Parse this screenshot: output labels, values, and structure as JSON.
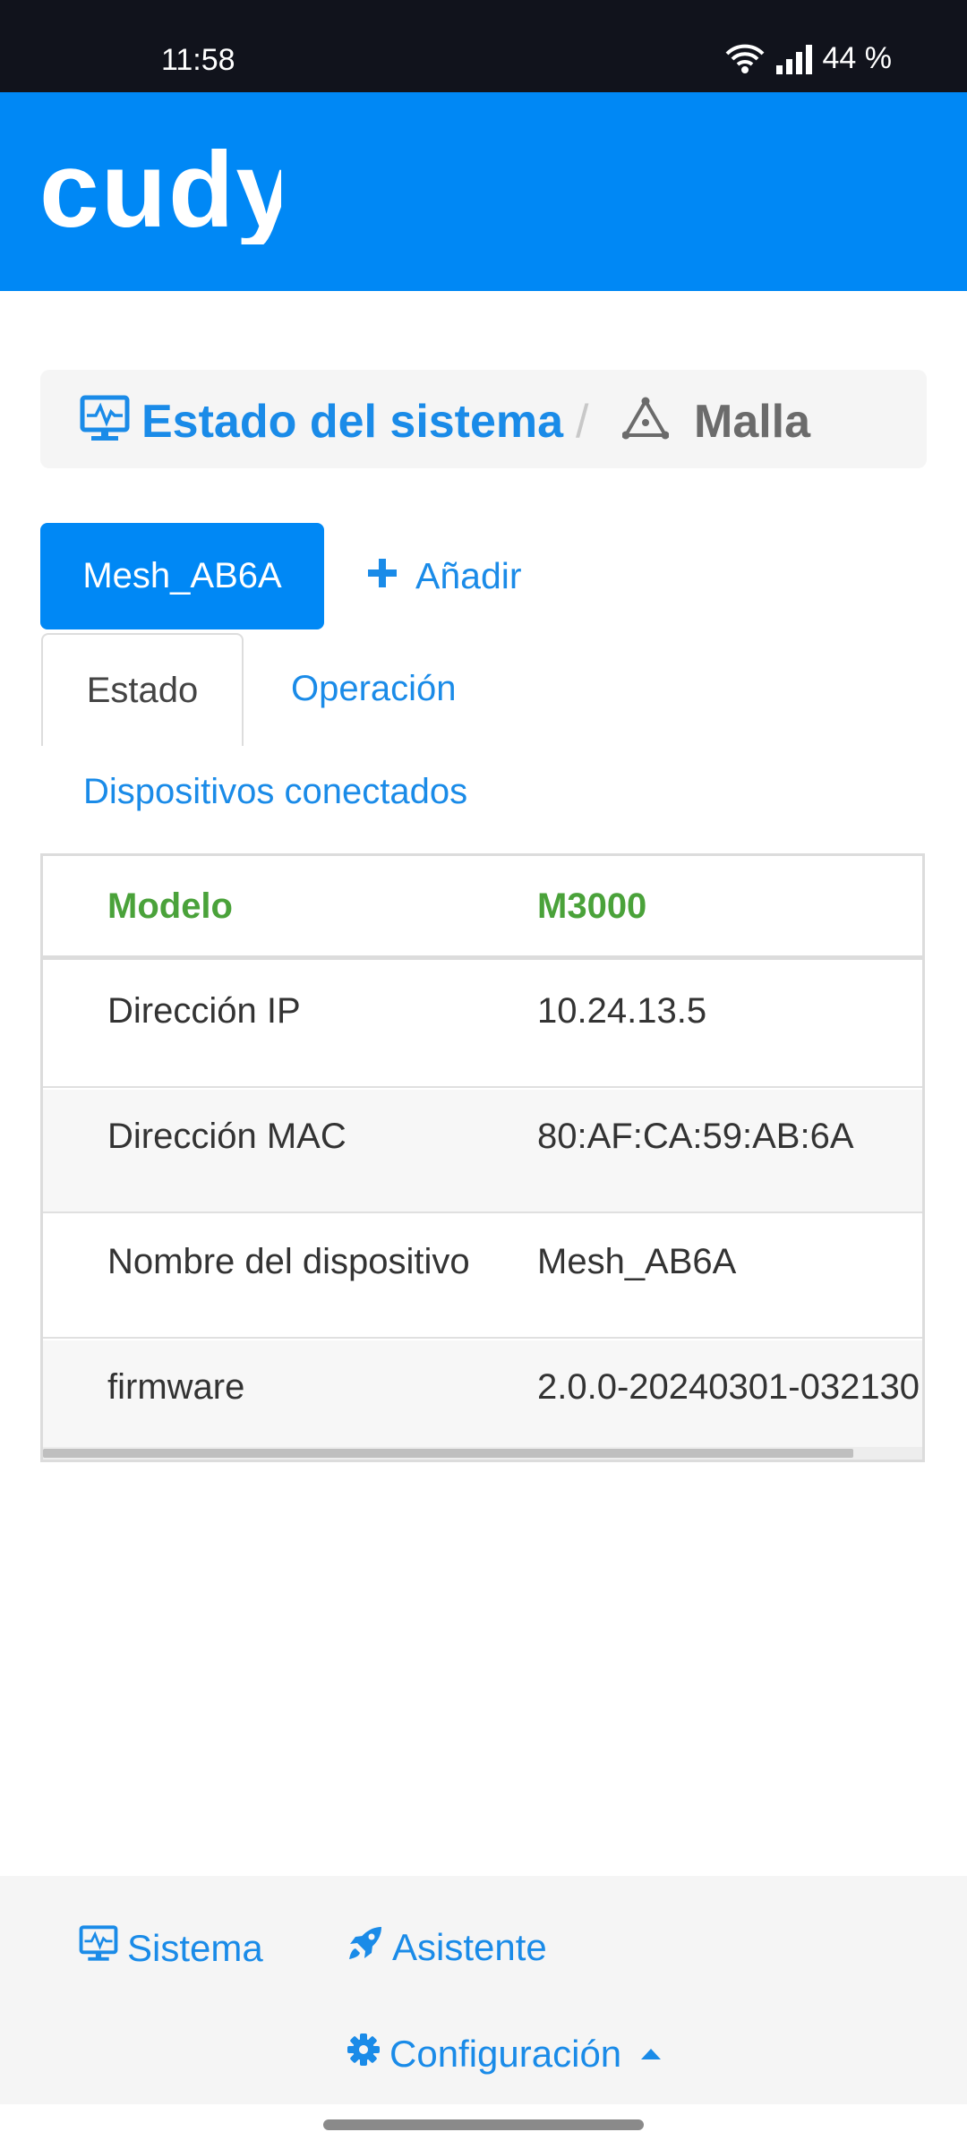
{
  "status_bar": {
    "time": "11:58",
    "battery": "44 %",
    "icons": [
      "wifi-icon",
      "signal-icon"
    ]
  },
  "header": {
    "logo_text": "cudy"
  },
  "breadcrumb": {
    "system_label": "Estado del sistema",
    "separator": "/",
    "current_label": "Malla",
    "icons": [
      "monitor-icon",
      "mesh-icon"
    ]
  },
  "devices": {
    "active_device": "Mesh_AB6A",
    "add_label": "Añadir"
  },
  "tabs": [
    {
      "label": "Estado",
      "active": true
    },
    {
      "label": "Operación",
      "active": false
    }
  ],
  "connected_devices_link": "Dispositivos conectados",
  "table": {
    "header": {
      "key": "Modelo",
      "value": "M3000"
    },
    "rows": [
      {
        "key": "Dirección IP",
        "value": "10.24.13.5"
      },
      {
        "key": "Dirección MAC",
        "value": "80:AF:CA:59:AB:6A"
      },
      {
        "key": "Nombre del dispositivo",
        "value": "Mesh_AB6A"
      },
      {
        "key": "firmware",
        "value": "2.0.0-20240301-032130"
      }
    ]
  },
  "bottom_nav": {
    "system": "Sistema",
    "assistant": "Asistente",
    "configuration": "Configuración",
    "icons": [
      "monitor-icon",
      "rocket-icon",
      "gear-icon",
      "caret-up-icon"
    ]
  },
  "colors": {
    "brand_blue": "#0088f5",
    "link_blue": "#1a8be8",
    "header_green": "#4aa23a",
    "status_bar": "#11131c"
  }
}
